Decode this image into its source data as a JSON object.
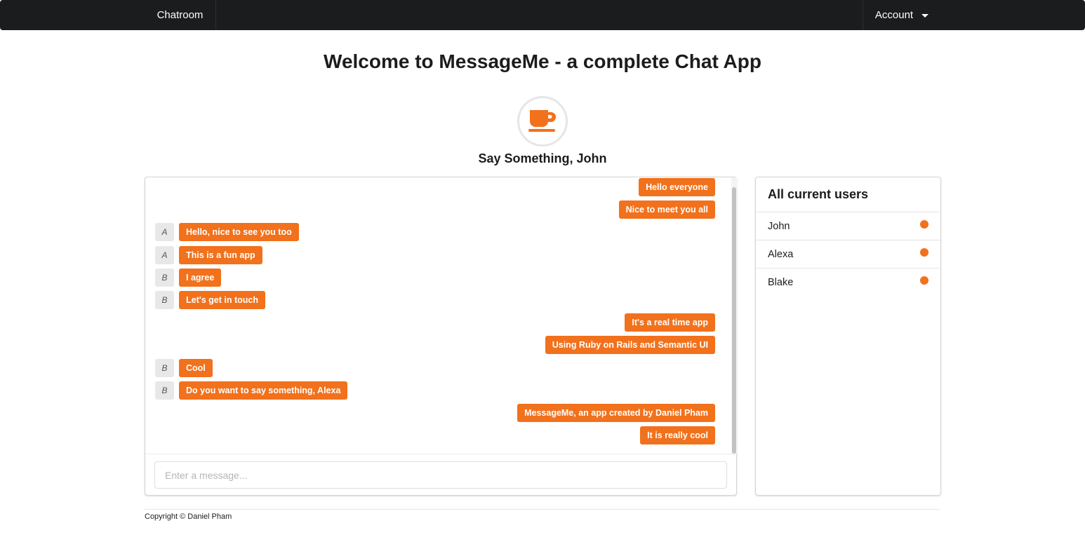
{
  "navbar": {
    "brand": "Chatroom",
    "account_label": "Account"
  },
  "page": {
    "title": "Welcome to MessageMe - a complete Chat App",
    "subtitle": "Say Something, John",
    "icon": "coffee-cup-icon"
  },
  "colors": {
    "accent": "#f2711c",
    "navbar": "#1b1c1d"
  },
  "messages": [
    {
      "text": "Hello everyone",
      "side": "right",
      "avatar": ""
    },
    {
      "text": "Nice to meet you all",
      "side": "right",
      "avatar": ""
    },
    {
      "text": "Hello, nice to see you too",
      "side": "left",
      "avatar": "A"
    },
    {
      "text": "This is a fun app",
      "side": "left",
      "avatar": "A"
    },
    {
      "text": "I agree",
      "side": "left",
      "avatar": "B"
    },
    {
      "text": "Let's get in touch",
      "side": "left",
      "avatar": "B"
    },
    {
      "text": "It's a real time app",
      "side": "right",
      "avatar": ""
    },
    {
      "text": "Using Ruby on Rails and Semantic UI",
      "side": "right",
      "avatar": ""
    },
    {
      "text": "Cool",
      "side": "left",
      "avatar": "B"
    },
    {
      "text": "Do you want to say something, Alexa",
      "side": "left",
      "avatar": "B"
    },
    {
      "text": "MessageMe, an app created by Daniel Pham",
      "side": "right",
      "avatar": ""
    },
    {
      "text": "It is really cool",
      "side": "right",
      "avatar": ""
    }
  ],
  "composer": {
    "placeholder": "Enter a message..."
  },
  "users_panel": {
    "title": "All current users",
    "users": [
      {
        "name": "John",
        "status": "online"
      },
      {
        "name": "Alexa",
        "status": "online"
      },
      {
        "name": "Blake",
        "status": "online"
      }
    ]
  },
  "footer": {
    "copyright": "Copyright © Daniel Pham"
  }
}
